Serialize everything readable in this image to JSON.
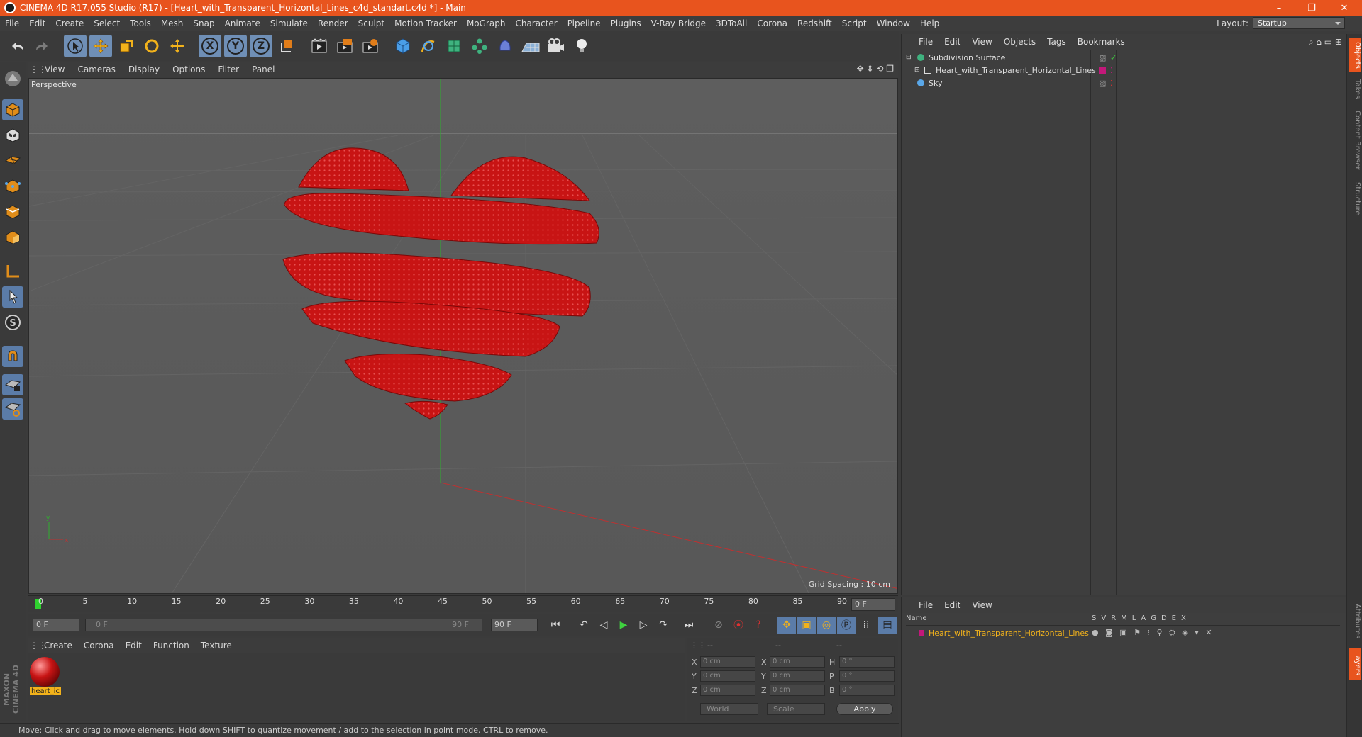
{
  "window": {
    "title": "CINEMA 4D R17.055 Studio (R17) - [Heart_with_Transparent_Horizontal_Lines_c4d_standart.c4d *] - Main",
    "minimize": "–",
    "maximize": "❐",
    "close": "✕"
  },
  "menu": [
    "File",
    "Edit",
    "Create",
    "Select",
    "Tools",
    "Mesh",
    "Snap",
    "Animate",
    "Simulate",
    "Render",
    "Sculpt",
    "Motion Tracker",
    "MoGraph",
    "Character",
    "Pipeline",
    "Plugins",
    "V-Ray Bridge",
    "3DToAll",
    "Corona",
    "Redshift",
    "Script",
    "Window",
    "Help"
  ],
  "layout": {
    "label": "Layout:",
    "value": "Startup"
  },
  "toolbar": {
    "x": "X",
    "y": "Y",
    "z": "Z"
  },
  "viewport": {
    "menu": [
      "View",
      "Cameras",
      "Display",
      "Options",
      "Filter",
      "Panel"
    ],
    "label": "Perspective",
    "grid_spacing": "Grid Spacing : 10 cm"
  },
  "timeline": {
    "ticks": [
      "0",
      "5",
      "10",
      "15",
      "20",
      "25",
      "30",
      "35",
      "40",
      "45",
      "50",
      "55",
      "60",
      "65",
      "70",
      "75",
      "80",
      "85",
      "90"
    ],
    "current_frame": "0 F",
    "start_frame": "0 F",
    "range_start": "0 F",
    "range_end": "90 F",
    "end_frame": "90 F"
  },
  "materials": {
    "menu": [
      "Create",
      "Corona",
      "Edit",
      "Function",
      "Texture"
    ],
    "items": [
      {
        "name": "heart_ic"
      }
    ]
  },
  "coordinates": {
    "headers": [
      "--",
      "--",
      "--"
    ],
    "rows": [
      {
        "a": "X",
        "v1": "0 cm",
        "b": "X",
        "v2": "0 cm",
        "c": "H",
        "v3": "0 °"
      },
      {
        "a": "Y",
        "v1": "0 cm",
        "b": "Y",
        "v2": "0 cm",
        "c": "P",
        "v3": "0 °"
      },
      {
        "a": "Z",
        "v1": "0 cm",
        "b": "Z",
        "v2": "0 cm",
        "c": "B",
        "v3": "0 °"
      }
    ],
    "mode": "World",
    "transform": "Scale",
    "apply": "Apply"
  },
  "status": "Move: Click and drag to move elements. Hold down SHIFT to quantize movement / add to the selection in point mode, CTRL to remove.",
  "objects": {
    "menu": [
      "File",
      "Edit",
      "View",
      "Objects",
      "Tags",
      "Bookmarks"
    ],
    "items": [
      {
        "name": "Subdivision Surface"
      },
      {
        "name": "Heart_with_Transparent_Horizontal_Lines"
      },
      {
        "name": "Sky"
      }
    ]
  },
  "layers": {
    "menu": [
      "File",
      "Edit",
      "View"
    ],
    "name_header": "Name",
    "columns": [
      "S",
      "V",
      "R",
      "M",
      "L",
      "A",
      "G",
      "D",
      "E",
      "X"
    ],
    "items": [
      {
        "name": "Heart_with_Transparent_Horizontal_Lines"
      }
    ]
  },
  "right_tabs": [
    "Objects",
    "Takes",
    "Content Browser",
    "Structure",
    "Attributes",
    "Layers"
  ],
  "brand": "MAXON CINEMA 4D",
  "colors": {
    "accent": "#e8541e",
    "heart": "#c81414",
    "layer_color": "#c2187a"
  }
}
